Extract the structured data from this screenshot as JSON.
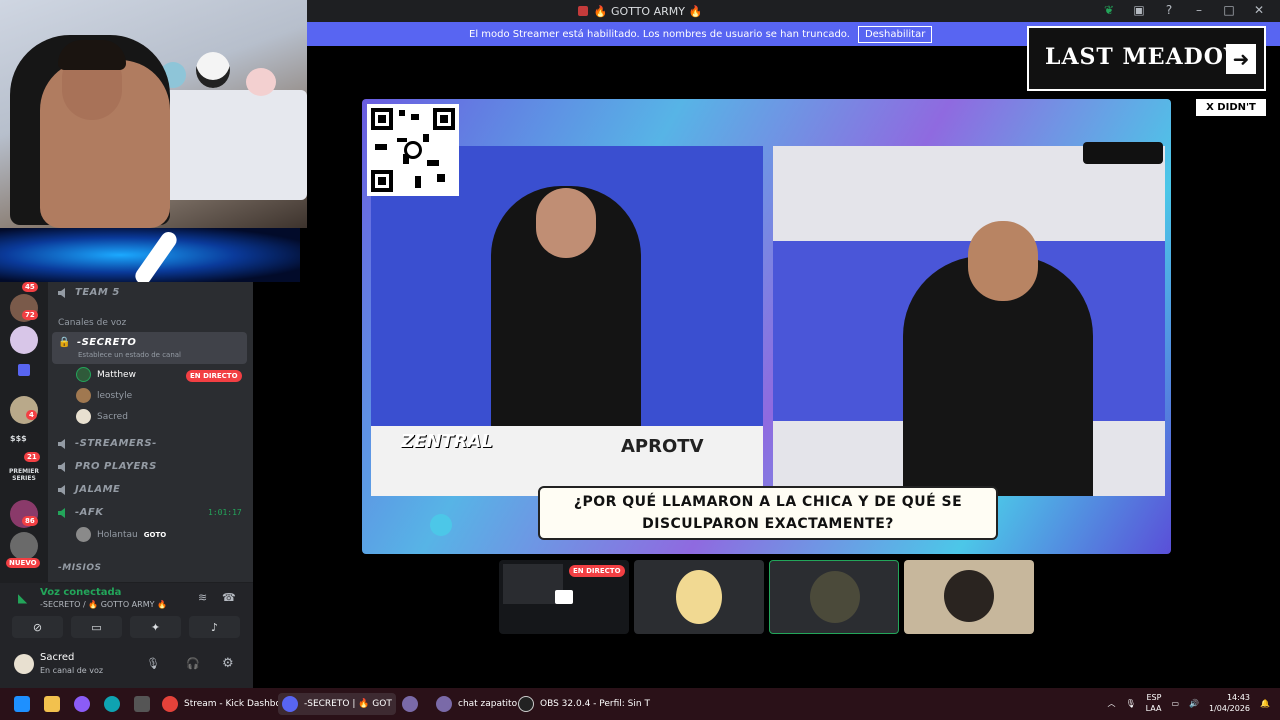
{
  "window": {
    "title": "🔥 GOTTO ARMY 🔥"
  },
  "banner": {
    "message": "El modo Streamer está habilitado. Los nombres de usuario se han truncado.",
    "button": "Deshabilitar"
  },
  "overlay": {
    "last_meadow": "LAST MEADOW",
    "arrow": "➜",
    "x_didnt_ask": "X DIDN'T ASK"
  },
  "video": {
    "caption_line1": "¿POR QUÉ LLAMARON A LA CHICA Y DE QUÉ SE",
    "caption_line2": "DISCULPARON EXACTAMENTE?",
    "brand_left": "ZENTRAL",
    "brand_right": "APROTV"
  },
  "thumbnails": {
    "live_badge": "EN DIRECTO"
  },
  "rail": {
    "badges": [
      "45",
      "72",
      "4",
      "21",
      "86"
    ],
    "money": "$$$",
    "premier": "PREMIER SERIES",
    "nuevo": "NUEVO"
  },
  "channels": {
    "team5": "TEAM 5",
    "category": "Canales de voz",
    "secreto": "-SECRETO",
    "status_hint": "Establece un estado de canal",
    "users": [
      {
        "name": "Matthew",
        "live": "EN DIRECTO"
      },
      {
        "name": "leostyle"
      },
      {
        "name": "Sacred"
      }
    ],
    "streamers": "-STREAMERS-",
    "pro_players": "PRO PLAYERS",
    "jalame": "JALAME",
    "afk": "-AFK",
    "afk_time": "1:01:17",
    "afk_user": "Holantau",
    "afk_user_tag": "GOTO",
    "misios": "-MISIOS"
  },
  "voice": {
    "status": "Voz conectada",
    "channel": "-SECRETO / 🔥 GOTTO ARMY 🔥",
    "username": "Sacred",
    "user_status": "En canal de voz"
  },
  "taskbar": {
    "items": [
      {
        "label": "Stream - Kick Dashboard"
      },
      {
        "label": "-SECRETO | 🔥 GOT"
      },
      {
        "label": ""
      },
      {
        "label": "chat zapatito"
      },
      {
        "label": "OBS 32.0.4 - Perfil: Sin T"
      }
    ],
    "lang1": "ESP",
    "lang2": "LAA",
    "time": "14:43",
    "date": "1/04/2026"
  }
}
